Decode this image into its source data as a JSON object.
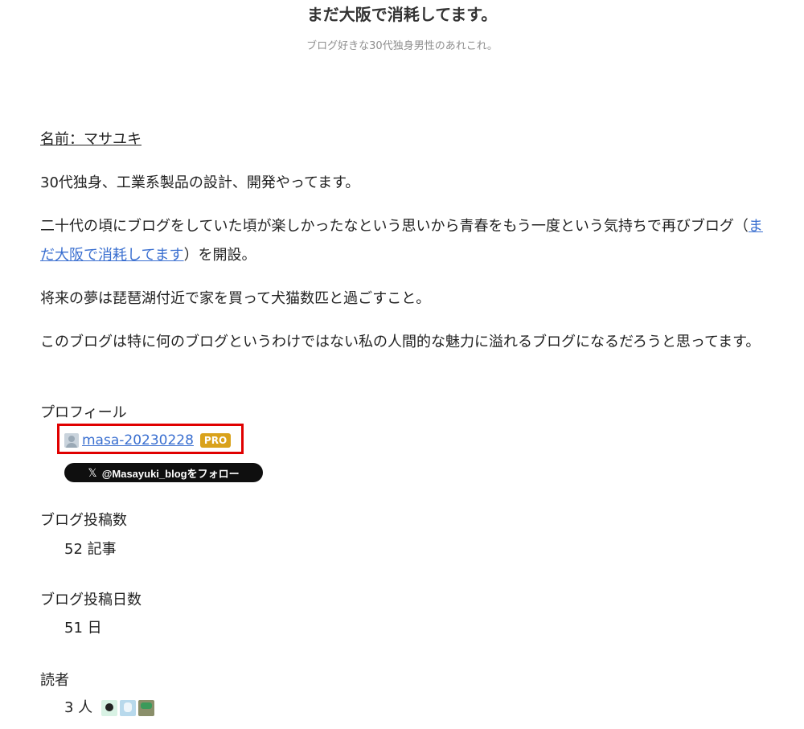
{
  "header": {
    "title": "まだ大阪で消耗してます。",
    "tagline": "ブログ好きな30代独身男性のあれこれ。"
  },
  "about": {
    "name_line": "名前：マサユキ",
    "p1": "30代独身、工業系製品の設計、開発やってます。",
    "p2_before": "二十代の頃にブログをしていた頃が楽しかったなという思いから青春をもう一度という気持ちで再びブログ（",
    "p2_link": "まだ大阪で消耗してます",
    "p2_after": "）を開設。",
    "p3": "将来の夢は琵琶湖付近で家を買って犬猫数匹と過ごすこと。",
    "p4": "このブログは特に何のブログというわけではない私の人間的な魅力に溢れるブログになるだろうと思ってます。"
  },
  "profile": {
    "heading": "プロフィール",
    "username": "masa-20230228",
    "badge": "PRO",
    "follow_label": "@Masayuki_blogをフォロー",
    "follow_icon": "𝕏"
  },
  "stats": {
    "posts_heading": "ブログ投稿数",
    "posts_value": "52 記事",
    "days_heading": "ブログ投稿日数",
    "days_value": "51 日",
    "readers_heading": "読者",
    "readers_value": "3 人"
  }
}
